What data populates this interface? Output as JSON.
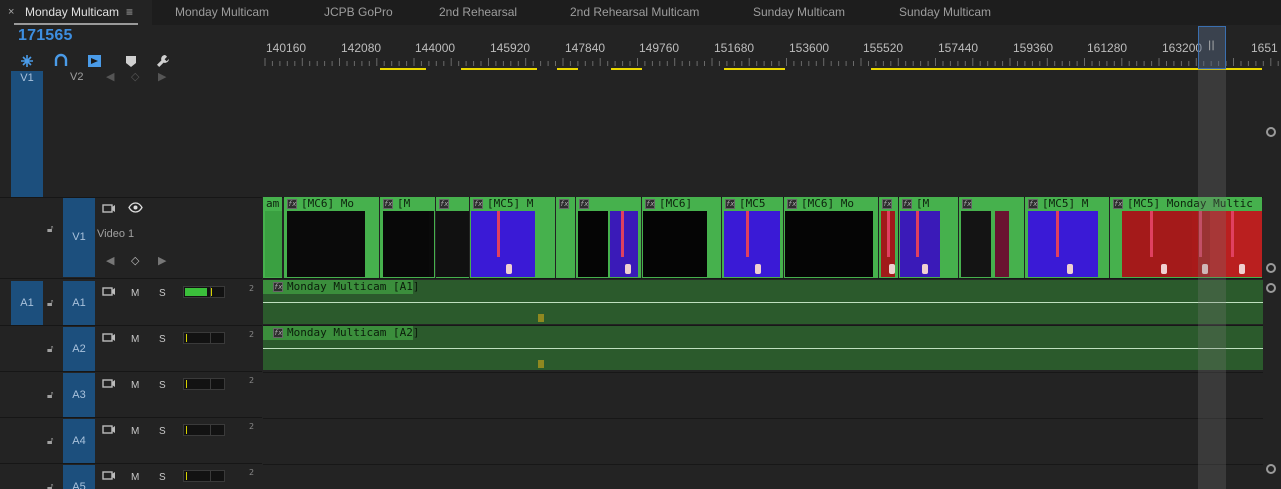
{
  "tabs": [
    {
      "label": "Monday Multicam",
      "active": true
    },
    {
      "label": "Monday Multicam"
    },
    {
      "label": "JCPB GoPro"
    },
    {
      "label": "2nd Rehearsal"
    },
    {
      "label": "2nd Rehearsal Multicam"
    },
    {
      "label": "Sunday Multicam"
    },
    {
      "label": "Sunday Multicam"
    }
  ],
  "tab_close": "×",
  "tab_menu": "≡",
  "timecode": "171565",
  "toolbar_icons": [
    "snap-icon",
    "linked-selection-icon",
    "add-marker-icon",
    "marker-icon",
    "wrench-icon"
  ],
  "ruler": {
    "labels": [
      "140160",
      "142080",
      "144000",
      "145920",
      "147840",
      "149760",
      "151680",
      "153600",
      "155520",
      "157440",
      "159360",
      "161280",
      "163200",
      "1651"
    ],
    "playhead_mark": "||"
  },
  "tracks": {
    "v1_target": "V1",
    "v2_label": "V2",
    "v1_label": "V1",
    "video1_name": "Video 1",
    "a1_target": "A1",
    "audio": [
      {
        "label": "A1",
        "m": "M",
        "s": "S",
        "ch": "2"
      },
      {
        "label": "A2",
        "m": "M",
        "s": "S",
        "ch": "2"
      },
      {
        "label": "A3",
        "m": "M",
        "s": "S",
        "ch": "2"
      },
      {
        "label": "A4",
        "m": "M",
        "s": "S",
        "ch": "2"
      },
      {
        "label": "A5",
        "m": "M",
        "s": "S",
        "ch": "2"
      }
    ]
  },
  "video_clips": [
    {
      "label": "am"
    },
    {
      "label": "[MC6] Mo"
    },
    {
      "label": "[M"
    },
    {
      "label": ""
    },
    {
      "label": "[MC5] M"
    },
    {
      "label": ""
    },
    {
      "label": ""
    },
    {
      "label": "[MC6]"
    },
    {
      "label": "[MC5"
    },
    {
      "label": "[MC6] Mo"
    },
    {
      "label": ""
    },
    {
      "label": "[M"
    },
    {
      "label": ""
    },
    {
      "label": "[MC5] M"
    },
    {
      "label": "[MC5] Monday Multic"
    }
  ],
  "audio_clips": [
    {
      "label": "Monday Multicam [A1]"
    },
    {
      "label": "Monday Multicam [A2]"
    }
  ],
  "colors": {
    "accent": "#3d8ee0",
    "clip_green": "#46b14d",
    "audio_green": "#2b5a2c",
    "work_area": "#e9d700",
    "target_blue": "#1c4f7d"
  }
}
